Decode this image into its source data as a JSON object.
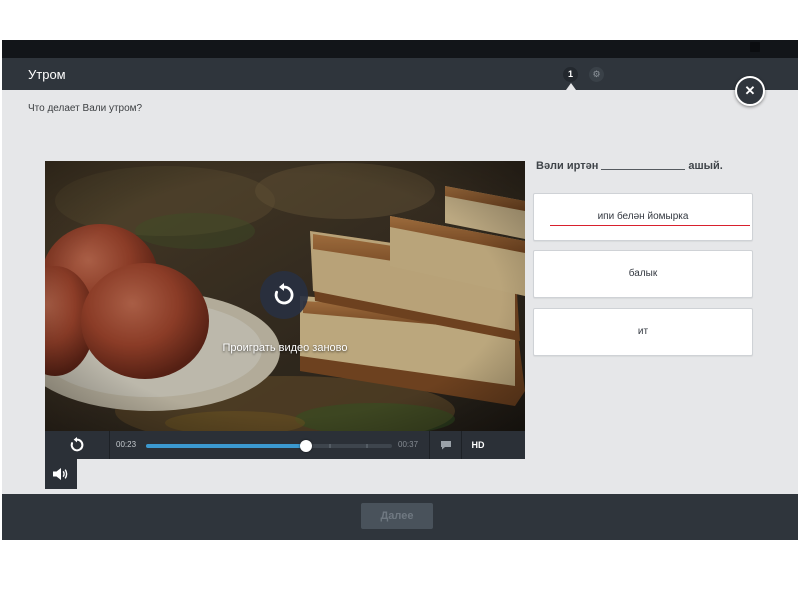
{
  "header": {
    "title": "Утром",
    "steps": [
      "1",
      "⚙"
    ],
    "close_icon": "close-icon"
  },
  "question": "Что делает Вали утром?",
  "video": {
    "overlay_text": "Проиграть видео заново",
    "time_current": "00:23",
    "time_total": "00:37",
    "progress": 0.65,
    "hd_label": "HD",
    "accent_color": "#3b99d0"
  },
  "exercise": {
    "sentence_before": "Вәли иртән",
    "sentence_after": "ашый.",
    "options": [
      "ипи белән йомырка",
      "балык",
      "ит"
    ],
    "selected_index": 0,
    "selected_color": "#d8202d"
  },
  "footer": {
    "next_label": "Далее"
  }
}
